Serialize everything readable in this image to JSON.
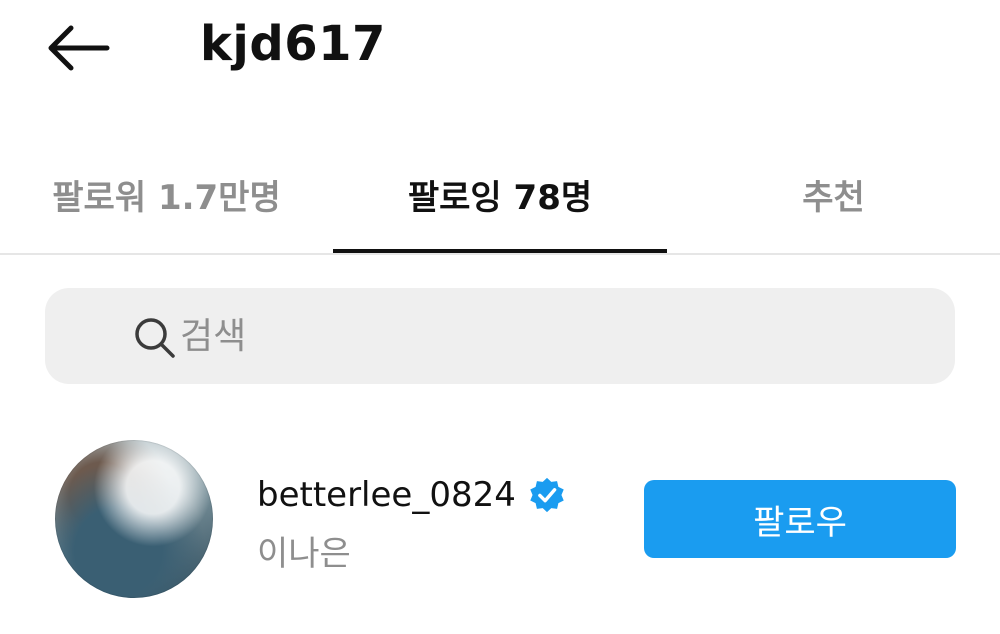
{
  "header": {
    "back_icon": "arrow-left-icon",
    "title": "kjd617"
  },
  "tabs": [
    {
      "label": "팔로워 1.7만명",
      "active": false
    },
    {
      "label": "팔로잉 78명",
      "active": true
    },
    {
      "label": "추천",
      "active": false
    }
  ],
  "search": {
    "icon": "search-icon",
    "placeholder": "검색",
    "value": ""
  },
  "following_list": [
    {
      "username": "betterlee_0824",
      "verified": true,
      "full_name": "이나은",
      "button_label": "팔로우"
    }
  ],
  "colors": {
    "accent": "#1a9cf0",
    "verified": "#1a9cf0",
    "muted_text": "#8e8e8e",
    "search_bg": "#efefef"
  }
}
